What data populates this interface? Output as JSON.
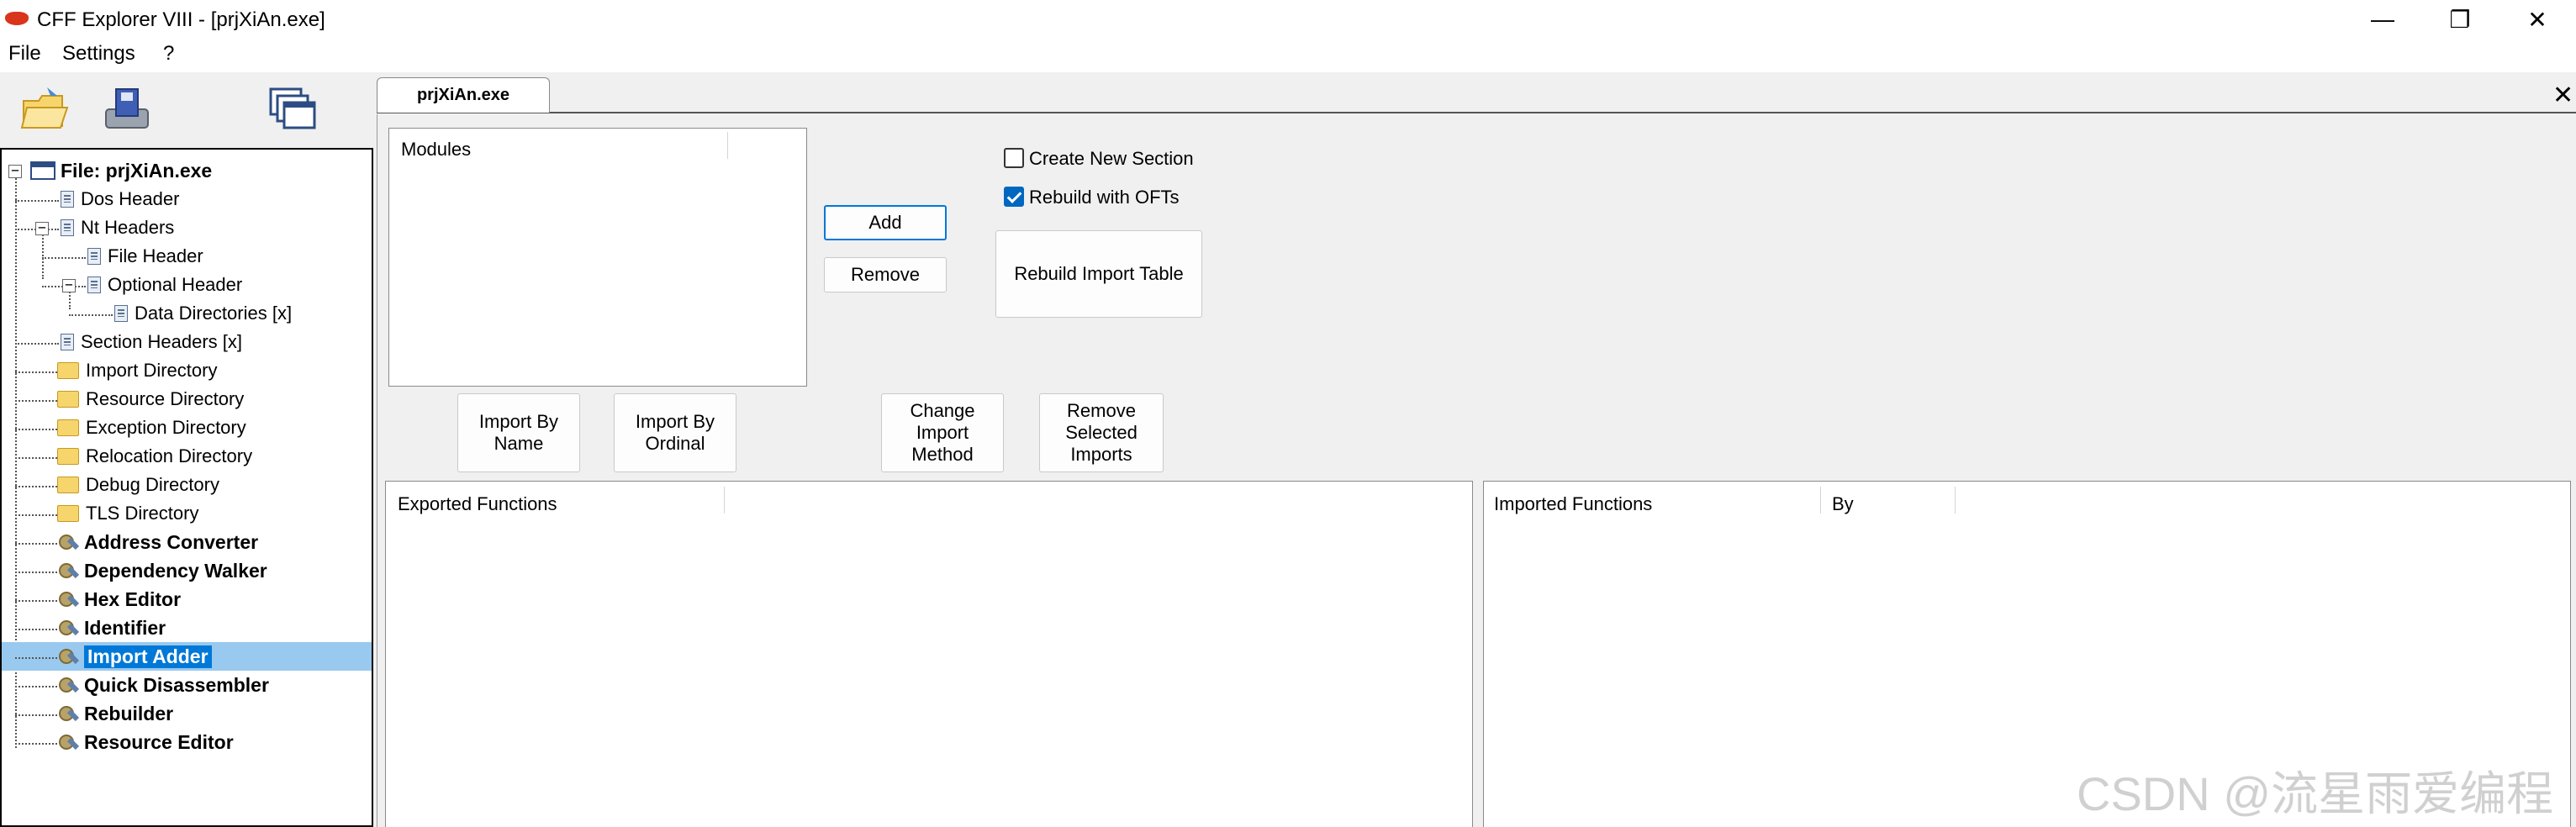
{
  "window": {
    "title": "CFF Explorer VIII - [prjXiAn.exe]",
    "minimize_glyph": "—",
    "maximize_glyph": "❐",
    "close_glyph": "✕"
  },
  "menu": {
    "items": [
      "File",
      "Settings",
      "?"
    ]
  },
  "toolbar": {
    "icons": [
      "open-file-icon",
      "save-file-icon",
      "windows-icon"
    ]
  },
  "tree": {
    "root": "File: prjXiAn.exe",
    "items": [
      {
        "label": "Dos Header"
      },
      {
        "label": "Nt Headers"
      },
      {
        "label": "File Header"
      },
      {
        "label": "Optional Header"
      },
      {
        "label": "Data Directories [x]"
      },
      {
        "label": "Section Headers [x]"
      },
      {
        "label": "Import Directory"
      },
      {
        "label": "Resource Directory"
      },
      {
        "label": "Exception Directory"
      },
      {
        "label": "Relocation Directory"
      },
      {
        "label": "Debug Directory"
      },
      {
        "label": "TLS Directory"
      },
      {
        "label": "Address Converter"
      },
      {
        "label": "Dependency Walker"
      },
      {
        "label": "Hex Editor"
      },
      {
        "label": "Identifier"
      },
      {
        "label": "Import Adder"
      },
      {
        "label": "Quick Disassembler"
      },
      {
        "label": "Rebuilder"
      },
      {
        "label": "Resource Editor"
      }
    ],
    "expander_minus": "−"
  },
  "tabs": {
    "active": "prjXiAn.exe",
    "close_glyph": "✕"
  },
  "import_adder": {
    "modules_header": "Modules",
    "add_button": "Add",
    "remove_button": "Remove",
    "create_new_section": "Create New Section",
    "rebuild_with_ofts": "Rebuild with OFTs",
    "create_new_section_checked": false,
    "rebuild_with_ofts_checked": true,
    "rebuild_import_table_button": "Rebuild Import Table",
    "import_by_name_button": [
      "Import By",
      "Name"
    ],
    "import_by_ordinal_button": [
      "Import By",
      "Ordinal"
    ],
    "change_import_method_button": [
      "Change",
      "Import",
      "Method"
    ],
    "remove_selected_imports_button": [
      "Remove",
      "Selected",
      "Imports"
    ],
    "exported_functions_header": "Exported Functions",
    "imported_functions_header": "Imported Functions",
    "by_header": "By"
  },
  "watermark": "CSDN @流星雨爱编程",
  "colors": {
    "selection": "#99c9ef",
    "selection_label": "#0078d7",
    "checkbox_on": "#0067c0"
  }
}
